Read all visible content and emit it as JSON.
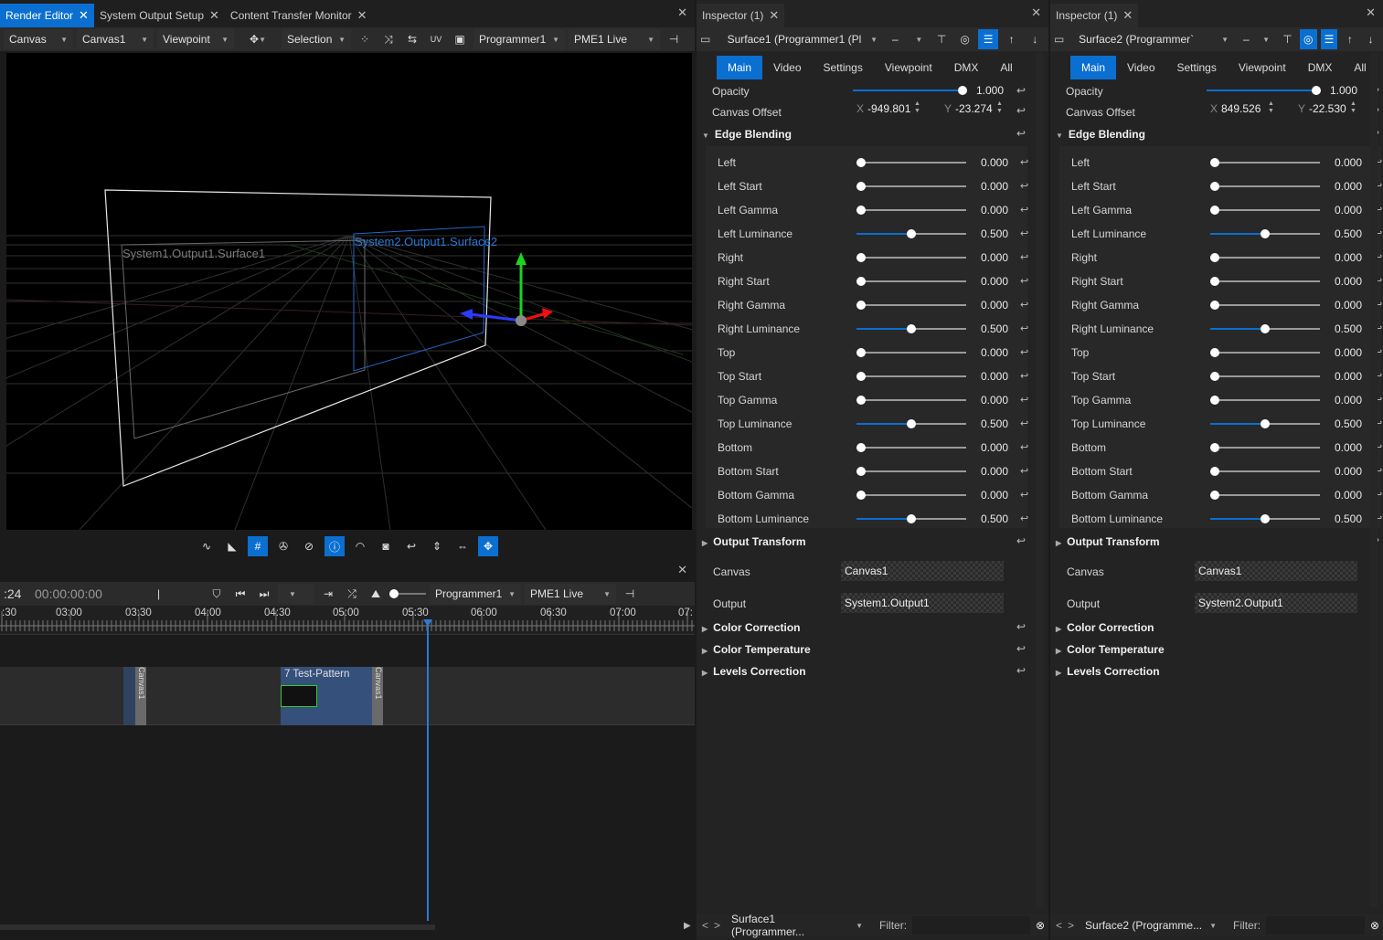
{
  "left_tabs": [
    "Render Editor",
    "System Output Setup",
    "Content Transfer Monitor"
  ],
  "render_toolbar": {
    "canvas": "Canvas",
    "canvas_sel": "Canvas1",
    "viewpoint": "Viewpoint",
    "selection": "Selection",
    "programmer": "Programmer1",
    "live": "PME1 Live"
  },
  "viewport": {
    "surface1_label": "System1.Output1.Surface1",
    "surface2_label": "System2.Output1.Surface2"
  },
  "timeline": {
    "frame": ":24",
    "timecode": "00:00:00:00",
    "programmer": "Programmer1",
    "live": "PME1 Live",
    "ticks": [
      ":30",
      "03:00",
      "03:30",
      "04:00",
      "04:30",
      "05:00",
      "05:30",
      "06:00",
      "06:30",
      "07:00",
      "07:"
    ],
    "clip_label": "7 Test-Pattern",
    "canvas_tag": "Canvas1"
  },
  "inspectors": [
    {
      "tab": "Inspector (1)",
      "object": "Surface1 (Programmer1 (Pl",
      "subtabs": [
        "Main",
        "Video",
        "Settings",
        "Viewpoint",
        "DMX",
        "All"
      ],
      "opacity_label": "Opacity",
      "opacity": "1.000",
      "offset_label": "Canvas Offset",
      "offset_x_label": "X",
      "offset_x": "-949.801",
      "offset_y_label": "Y",
      "offset_y": "-23.274",
      "edge_title": "Edge Blending",
      "params": [
        {
          "name": "Left",
          "val": "0.000",
          "frac": 0
        },
        {
          "name": "Left Start",
          "val": "0.000",
          "frac": 0
        },
        {
          "name": "Left Gamma",
          "val": "0.000",
          "frac": 0
        },
        {
          "name": "Left Luminance",
          "val": "0.500",
          "frac": 0.5
        },
        {
          "name": "Right",
          "val": "0.000",
          "frac": 0
        },
        {
          "name": "Right Start",
          "val": "0.000",
          "frac": 0
        },
        {
          "name": "Right Gamma",
          "val": "0.000",
          "frac": 0
        },
        {
          "name": "Right Luminance",
          "val": "0.500",
          "frac": 0.5
        },
        {
          "name": "Top",
          "val": "0.000",
          "frac": 0
        },
        {
          "name": "Top Start",
          "val": "0.000",
          "frac": 0
        },
        {
          "name": "Top Gamma",
          "val": "0.000",
          "frac": 0
        },
        {
          "name": "Top Luminance",
          "val": "0.500",
          "frac": 0.5
        },
        {
          "name": "Bottom",
          "val": "0.000",
          "frac": 0
        },
        {
          "name": "Bottom Start",
          "val": "0.000",
          "frac": 0
        },
        {
          "name": "Bottom Gamma",
          "val": "0.000",
          "frac": 0
        },
        {
          "name": "Bottom Luminance",
          "val": "0.500",
          "frac": 0.5
        }
      ],
      "output_transform": "Output Transform",
      "canvas_label": "Canvas",
      "canvas_val": "Canvas1",
      "output_label": "Output",
      "output_val": "System1.Output1",
      "sections": [
        "Color Correction",
        "Color Temperature",
        "Levels Correction"
      ],
      "footer_obj": "Surface1 (Programmer...",
      "filter": "Filter:"
    },
    {
      "tab": "Inspector (1)",
      "object": "Surface2 (Programmer`",
      "subtabs": [
        "Main",
        "Video",
        "Settings",
        "Viewpoint",
        "DMX",
        "All"
      ],
      "opacity_label": "Opacity",
      "opacity": "1.000",
      "offset_label": "Canvas Offset",
      "offset_x_label": "X",
      "offset_x": "849.526",
      "offset_y_label": "Y",
      "offset_y": "-22.530",
      "edge_title": "Edge Blending",
      "params": [
        {
          "name": "Left",
          "val": "0.000",
          "frac": 0
        },
        {
          "name": "Left Start",
          "val": "0.000",
          "frac": 0
        },
        {
          "name": "Left Gamma",
          "val": "0.000",
          "frac": 0
        },
        {
          "name": "Left Luminance",
          "val": "0.500",
          "frac": 0.5
        },
        {
          "name": "Right",
          "val": "0.000",
          "frac": 0
        },
        {
          "name": "Right Start",
          "val": "0.000",
          "frac": 0
        },
        {
          "name": "Right Gamma",
          "val": "0.000",
          "frac": 0
        },
        {
          "name": "Right Luminance",
          "val": "0.500",
          "frac": 0.5
        },
        {
          "name": "Top",
          "val": "0.000",
          "frac": 0
        },
        {
          "name": "Top Start",
          "val": "0.000",
          "frac": 0
        },
        {
          "name": "Top Gamma",
          "val": "0.000",
          "frac": 0
        },
        {
          "name": "Top Luminance",
          "val": "0.500",
          "frac": 0.5
        },
        {
          "name": "Bottom",
          "val": "0.000",
          "frac": 0
        },
        {
          "name": "Bottom Start",
          "val": "0.000",
          "frac": 0
        },
        {
          "name": "Bottom Gamma",
          "val": "0.000",
          "frac": 0
        },
        {
          "name": "Bottom Luminance",
          "val": "0.500",
          "frac": 0.5
        }
      ],
      "output_transform": "Output Transform",
      "canvas_label": "Canvas",
      "canvas_val": "Canvas1",
      "output_label": "Output",
      "output_val": "System2.Output1",
      "sections": [
        "Color Correction",
        "Color Temperature",
        "Levels Correction"
      ],
      "footer_obj": "Surface2 (Programme...",
      "filter": "Filter:"
    }
  ],
  "accent": "#0a6fd1"
}
